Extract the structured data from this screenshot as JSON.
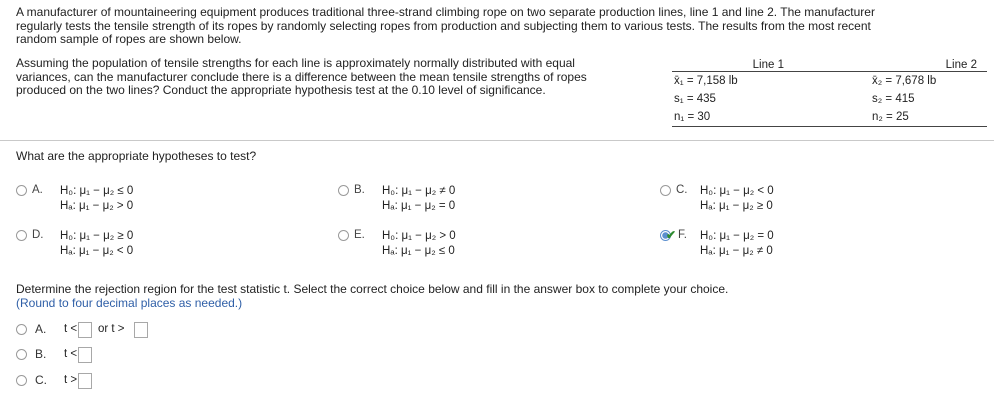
{
  "problem": {
    "line1": "A manufacturer of mountaineering equipment produces traditional three-strand climbing rope on two separate production lines, line 1 and line 2. The manufacturer",
    "line2": "regularly tests the tensile strength of its ropes by randomly selecting ropes from production and subjecting them to various tests. The results from the most recent",
    "line3": "random sample of ropes are shown below.",
    "assume1": "Assuming the population of tensile strengths for each line is approximately normally distributed with equal",
    "assume2": "variances, can the manufacturer conclude there is a difference between the mean tensile strengths of ropes",
    "assume3": "produced on the two lines? Conduct the appropriate hypothesis test at the 0.10 level of significance."
  },
  "stats": {
    "headers": [
      "Line 1",
      "Line 2"
    ],
    "rows": [
      [
        "x̄₁ = 7,158 lb",
        "x̄₂ = 7,678 lb"
      ],
      [
        "s₁ = 435",
        "s₂ = 415"
      ],
      [
        "n₁ = 30",
        "n₂ = 25"
      ]
    ]
  },
  "question1": "What are the appropriate hypotheses to test?",
  "hypotheses": [
    {
      "letter": "A.",
      "h0": "H₀: μ₁ − μ₂ ≤ 0",
      "ha": "Hₐ: μ₁ − μ₂ > 0",
      "selected": false
    },
    {
      "letter": "B.",
      "h0": "H₀: μ₁ − μ₂ ≠ 0",
      "ha": "Hₐ: μ₁ − μ₂ = 0",
      "selected": false
    },
    {
      "letter": "C.",
      "h0": "H₀: μ₁ − μ₂ < 0",
      "ha": "Hₐ: μ₁ − μ₂ ≥ 0",
      "selected": false
    },
    {
      "letter": "D.",
      "h0": "H₀: μ₁ − μ₂ ≥ 0",
      "ha": "Hₐ: μ₁ − μ₂ < 0",
      "selected": false
    },
    {
      "letter": "E.",
      "h0": "H₀: μ₁ − μ₂ > 0",
      "ha": "Hₐ: μ₁ − μ₂ ≤ 0",
      "selected": false
    },
    {
      "letter": "F.",
      "h0": "H₀: μ₁ − μ₂ = 0",
      "ha": "Hₐ: μ₁ − μ₂ ≠ 0",
      "selected": true
    }
  ],
  "question2": "Determine the rejection region for the test statistic t. Select the correct choice below and fill in the answer box to complete your choice.",
  "question2_hint": "(Round to four decimal places as needed.)",
  "answers": [
    {
      "letter": "A.",
      "pre": "t <",
      "mid": "or t >"
    },
    {
      "letter": "B.",
      "pre": "t <"
    },
    {
      "letter": "C.",
      "pre": "t >"
    }
  ],
  "colors": {
    "selected": "#5b8fcf",
    "check": "#2e8b2e",
    "hint": "#2f5fa7"
  }
}
